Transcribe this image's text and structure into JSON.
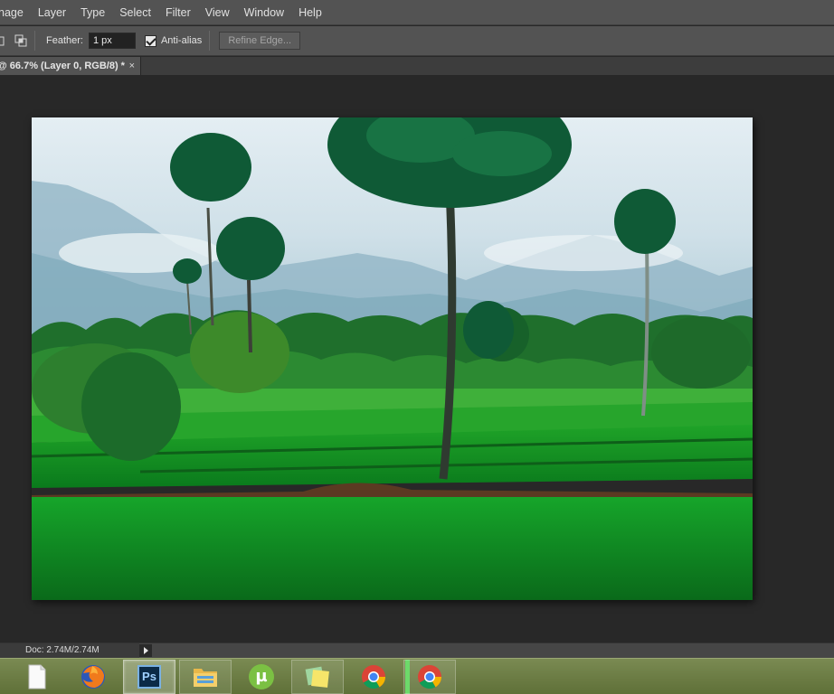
{
  "menu": {
    "items": [
      "nage",
      "Layer",
      "Type",
      "Select",
      "Filter",
      "View",
      "Window",
      "Help"
    ]
  },
  "options": {
    "feather_label": "Feather:",
    "feather_value": "1 px",
    "antialias_label": "Anti-alias",
    "antialias_checked": true,
    "refine_edge_label": "Refine Edge..."
  },
  "document_tab": {
    "title": "@ 66.7% (Layer 0, RGB/8) *",
    "close_glyph": "×"
  },
  "status": {
    "doc_size": "Doc: 2.74M/2.74M"
  },
  "taskbar": {
    "apps": [
      {
        "name": "blank-document",
        "state": "idle"
      },
      {
        "name": "firefox",
        "state": "idle"
      },
      {
        "name": "photoshop",
        "label": "Ps",
        "state": "active"
      },
      {
        "name": "file-explorer",
        "state": "running"
      },
      {
        "name": "utorrent",
        "label": "µ",
        "state": "idle"
      },
      {
        "name": "sticky-notes",
        "state": "running"
      },
      {
        "name": "chrome",
        "state": "idle"
      },
      {
        "name": "chrome",
        "state": "running"
      }
    ]
  },
  "colors": {
    "chrome_bg": "#535353",
    "canvas_bg": "#282828",
    "taskbar_green": "#6e7f45"
  }
}
